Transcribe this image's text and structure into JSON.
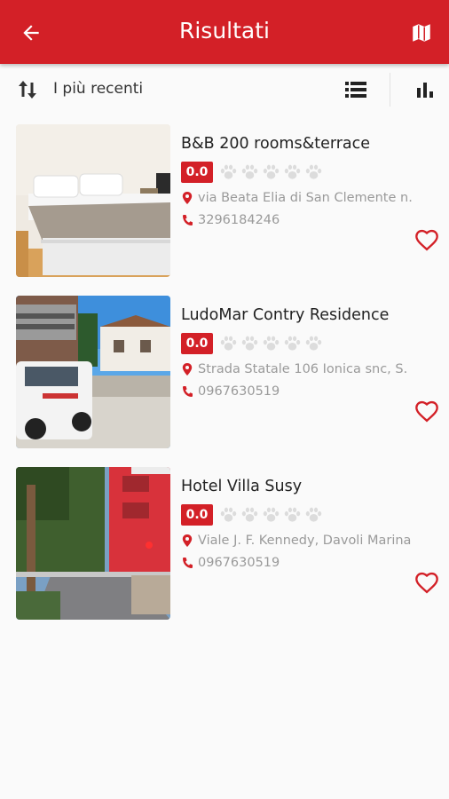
{
  "appbar": {
    "title": "Risultati",
    "back_icon": "arrow-left-icon",
    "map_icon": "map-icon",
    "color": "#d32027"
  },
  "toolbar": {
    "sort_label": "I più recenti",
    "sort_icon": "sort-arrows-icon",
    "list_icon": "list-view-icon",
    "stats_icon": "bar-chart-icon"
  },
  "results": [
    {
      "name": "B&B 200 rooms&terrace",
      "rating": "0.0",
      "paws_filled": 0,
      "paws_total": 5,
      "address": "via Beata Elia di San Clemente n.",
      "phone": "3296184246",
      "favorite": false
    },
    {
      "name": "LudoMar Contry Residence",
      "rating": "0.0",
      "paws_filled": 0,
      "paws_total": 5,
      "address": "Strada Statale 106 Ionica snc, S.",
      "phone": "0967630519",
      "favorite": false
    },
    {
      "name": "Hotel Villa Susy",
      "rating": "0.0",
      "paws_filled": 0,
      "paws_total": 5,
      "address": "Viale J. F. Kennedy, Davoli Marina",
      "phone": "0967630519",
      "favorite": false
    }
  ]
}
